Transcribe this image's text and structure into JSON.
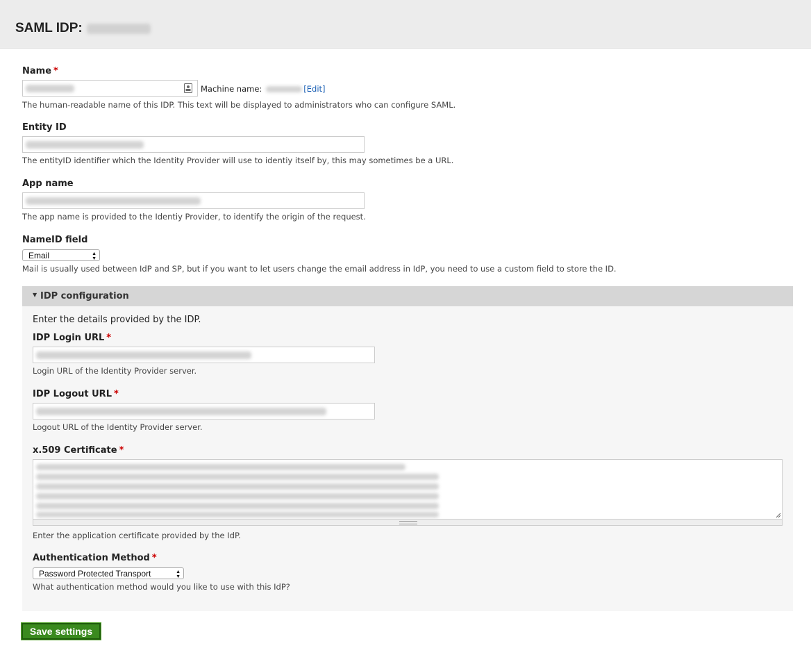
{
  "header": {
    "title": "SAML IDP:"
  },
  "form": {
    "name": {
      "label": "Name",
      "required": "*",
      "machine_name_label": "Machine name:",
      "edit_link": "[Edit]",
      "description": "The human-readable name of this IDP. This text will be displayed to administrators who can configure SAML."
    },
    "entity_id": {
      "label": "Entity ID",
      "description": "The entityID identifier which the Identity Provider will use to identiy itself by, this may sometimes be a URL."
    },
    "app_name": {
      "label": "App name",
      "description": "The app name is provided to the Identiy Provider, to identify the origin of the request."
    },
    "nameid": {
      "label": "NameID field",
      "selected": "Email",
      "description": "Mail is usually used between IdP and SP, but if you want to let users change the email address in IdP, you need to use a custom field to store the ID."
    }
  },
  "idp_config": {
    "legend": "IDP configuration",
    "intro": "Enter the details provided by the IDP.",
    "login_url": {
      "label": "IDP Login URL",
      "required": "*",
      "description": "Login URL of the Identity Provider server."
    },
    "logout_url": {
      "label": "IDP Logout URL",
      "required": "*",
      "description": "Logout URL of the Identity Provider server."
    },
    "certificate": {
      "label": "x.509 Certificate",
      "required": "*",
      "description": "Enter the application certificate provided by the IdP."
    },
    "auth_method": {
      "label": "Authentication Method",
      "required": "*",
      "selected": "Password Protected Transport",
      "description": "What authentication method would you like to use with this IdP?"
    }
  },
  "actions": {
    "save_label": "Save settings"
  },
  "colors": {
    "save_button": "#3a8a1e",
    "required": "#cc0000",
    "link": "#1a5fb4"
  },
  "icons": {
    "contact_card": "contact-card-icon",
    "select_arrows": "select-arrows-icon",
    "legend_toggle": "triangle-down-icon",
    "resize": "resize-grip-icon"
  }
}
